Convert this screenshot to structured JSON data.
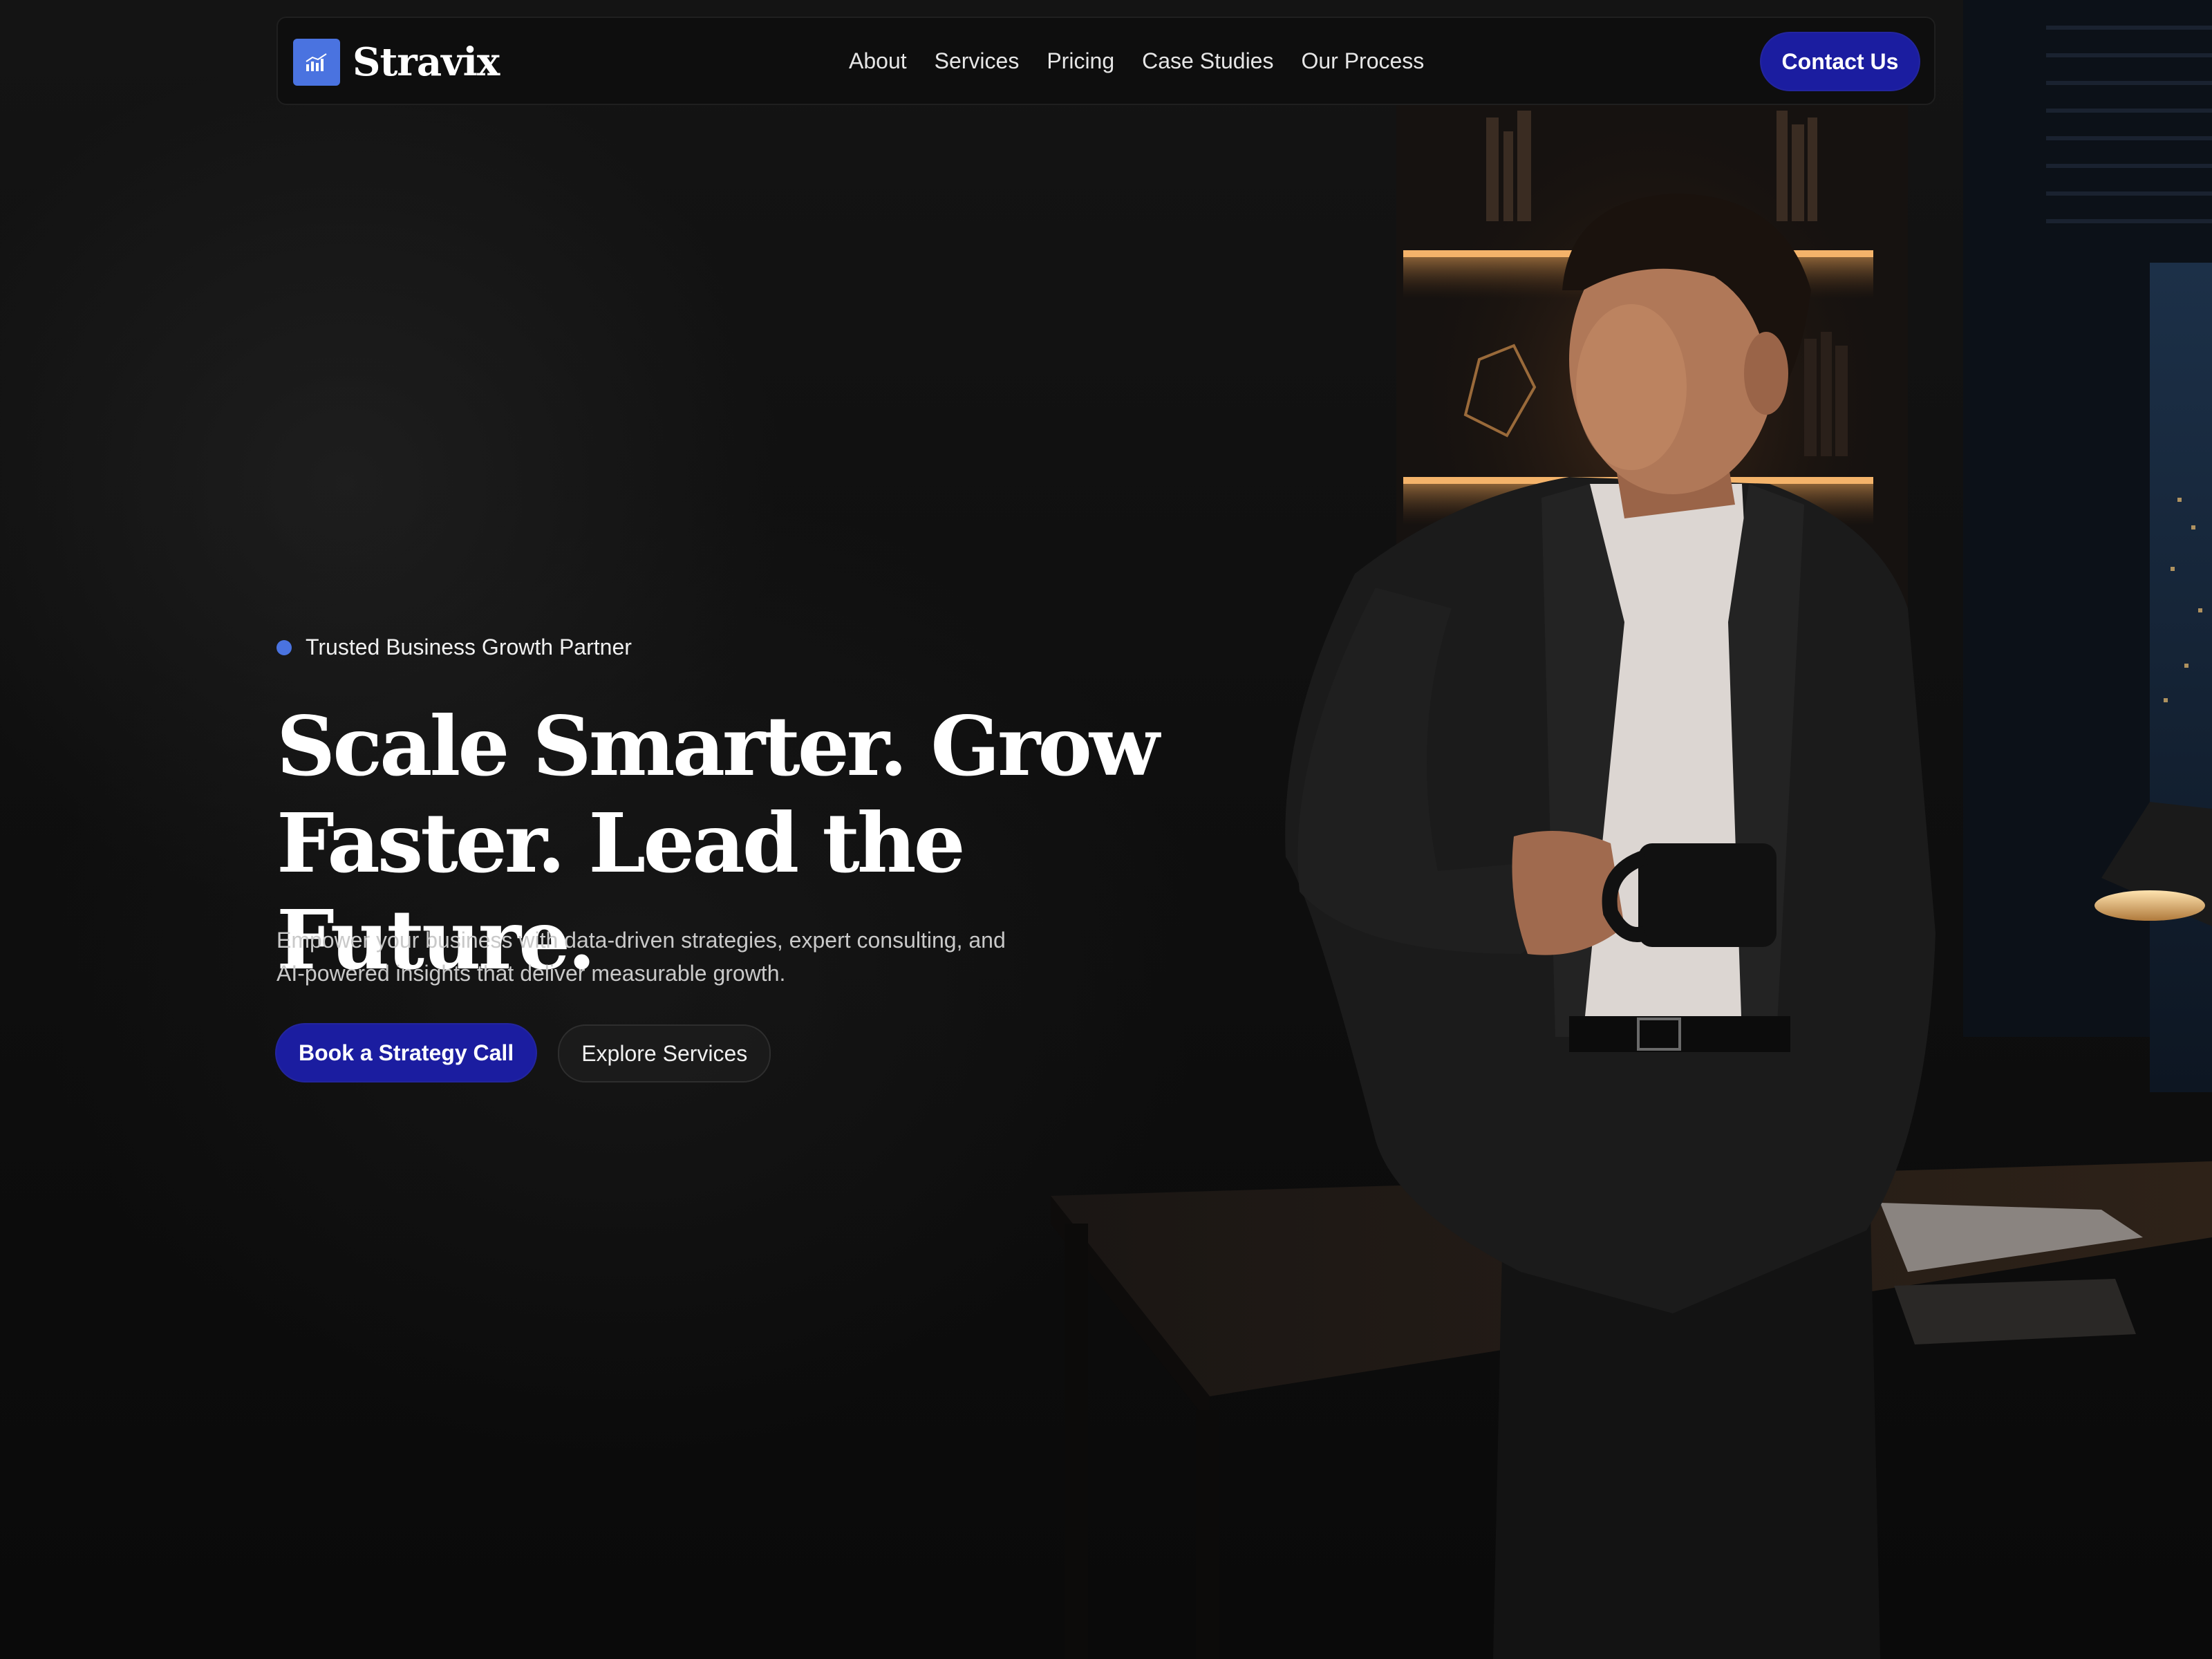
{
  "brand": {
    "name": "Stravix",
    "logo_icon": "bar-chart-icon",
    "accent_color": "#4a73e0",
    "button_color": "#1b1da0"
  },
  "nav": {
    "links": [
      "About",
      "Services",
      "Pricing",
      "Case Studies",
      "Our Process"
    ],
    "cta_label": "Contact Us"
  },
  "hero": {
    "badge": "Trusted Business Growth Partner",
    "headline_line1": "Scale Smarter. Grow",
    "headline_line2": "Faster. Lead the Future.",
    "subhead": "Empower your business with data-driven strategies, expert consulting, and AI-powered insights that deliver measurable growth.",
    "primary_cta": "Book a Strategy Call",
    "secondary_cta": "Explore Services"
  }
}
